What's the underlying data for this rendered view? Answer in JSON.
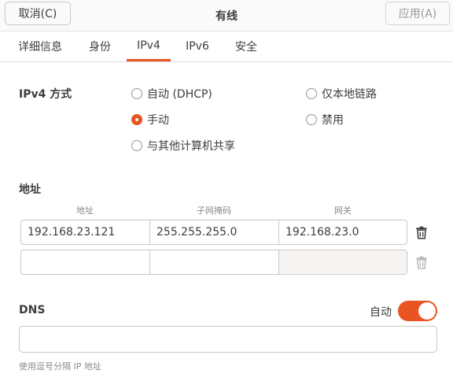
{
  "header": {
    "cancel_label": "取消(C)",
    "title": "有线",
    "apply_label": "应用(A)"
  },
  "tabs": [
    {
      "label": "详细信息"
    },
    {
      "label": "身份"
    },
    {
      "label": "IPv4"
    },
    {
      "label": "IPv6"
    },
    {
      "label": "安全"
    }
  ],
  "active_tab": "IPv4",
  "method": {
    "label": "IPv4 方式",
    "options": [
      {
        "label": "自动 (DHCP)",
        "selected": false
      },
      {
        "label": "手动",
        "selected": true
      },
      {
        "label": "与其他计算机共享",
        "selected": false
      },
      {
        "label": "仅本地链路",
        "selected": false
      },
      {
        "label": "禁用",
        "selected": false
      }
    ]
  },
  "address": {
    "section_label": "地址",
    "columns": [
      "地址",
      "子网掩码",
      "网关"
    ],
    "rows": [
      [
        "192.168.23.121",
        "255.255.255.0",
        "192.168.23.0"
      ],
      [
        "",
        "",
        ""
      ]
    ]
  },
  "dns": {
    "label": "DNS",
    "auto_label": "自动",
    "auto_enabled": true,
    "value": "",
    "hint": "使用逗号分隔 IP 地址"
  },
  "colors": {
    "accent": "#e95420"
  }
}
